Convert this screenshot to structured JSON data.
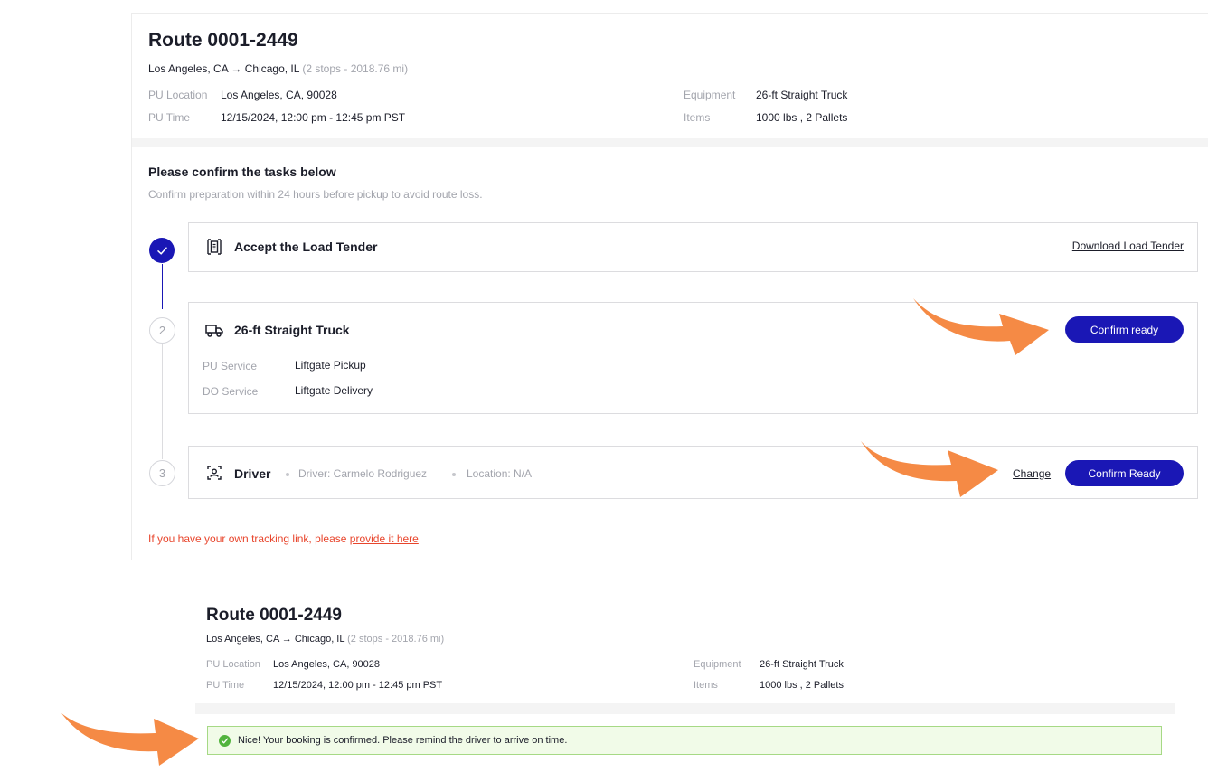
{
  "route": {
    "title": "Route 0001-2449",
    "origin_dest": "Los Angeles, CA → Chicago, IL",
    "stops_info": "(2 stops - 2018.76 mi)",
    "pu_location_label": "PU Location",
    "pu_location_value": "Los Angeles, CA, 90028",
    "pu_time_label": "PU Time",
    "pu_time_value": "12/15/2024, 12:00 pm - 12:45 pm PST",
    "equipment_label": "Equipment",
    "equipment_value": "26-ft Straight Truck",
    "items_label": "Items",
    "items_value": "1000 lbs , 2 Pallets"
  },
  "tasks": {
    "title": "Please confirm the tasks below",
    "subtitle": "Confirm preparation within 24 hours before pickup to avoid route loss.",
    "step2_number": "2",
    "step3_number": "3",
    "load_tender": {
      "title": "Accept the Load Tender",
      "download_link": "Download Load Tender"
    },
    "truck": {
      "title": "26-ft Straight Truck",
      "confirm_button": "Confirm ready",
      "pu_service_label": "PU Service",
      "pu_service_value": "Liftgate Pickup",
      "do_service_label": "DO Service",
      "do_service_value": "Liftgate Delivery"
    },
    "driver": {
      "title": "Driver",
      "driver_info": "Driver: Carmelo Rodriguez",
      "location_info": "Location: N/A",
      "change_link": "Change",
      "confirm_button": "Confirm Ready"
    }
  },
  "tracking": {
    "text": "If you have your own tracking link, please",
    "link": "provide it here"
  },
  "confirmation": {
    "message": "Nice! Your booking is confirmed. Please remind the driver to arrive on time."
  },
  "icons": {
    "step_done": "check-icon",
    "load_tender": "document-icon",
    "truck": "truck-icon",
    "driver": "driver-badge-icon",
    "success": "check-circle-icon",
    "annotation": "orange-arrow-icon"
  },
  "colors": {
    "primary": "#1a17b5",
    "link_red": "#e8452c",
    "success_bg": "#f1fbe8",
    "success_border": "#a6d985",
    "annotation_arrow": "#f58a45"
  }
}
